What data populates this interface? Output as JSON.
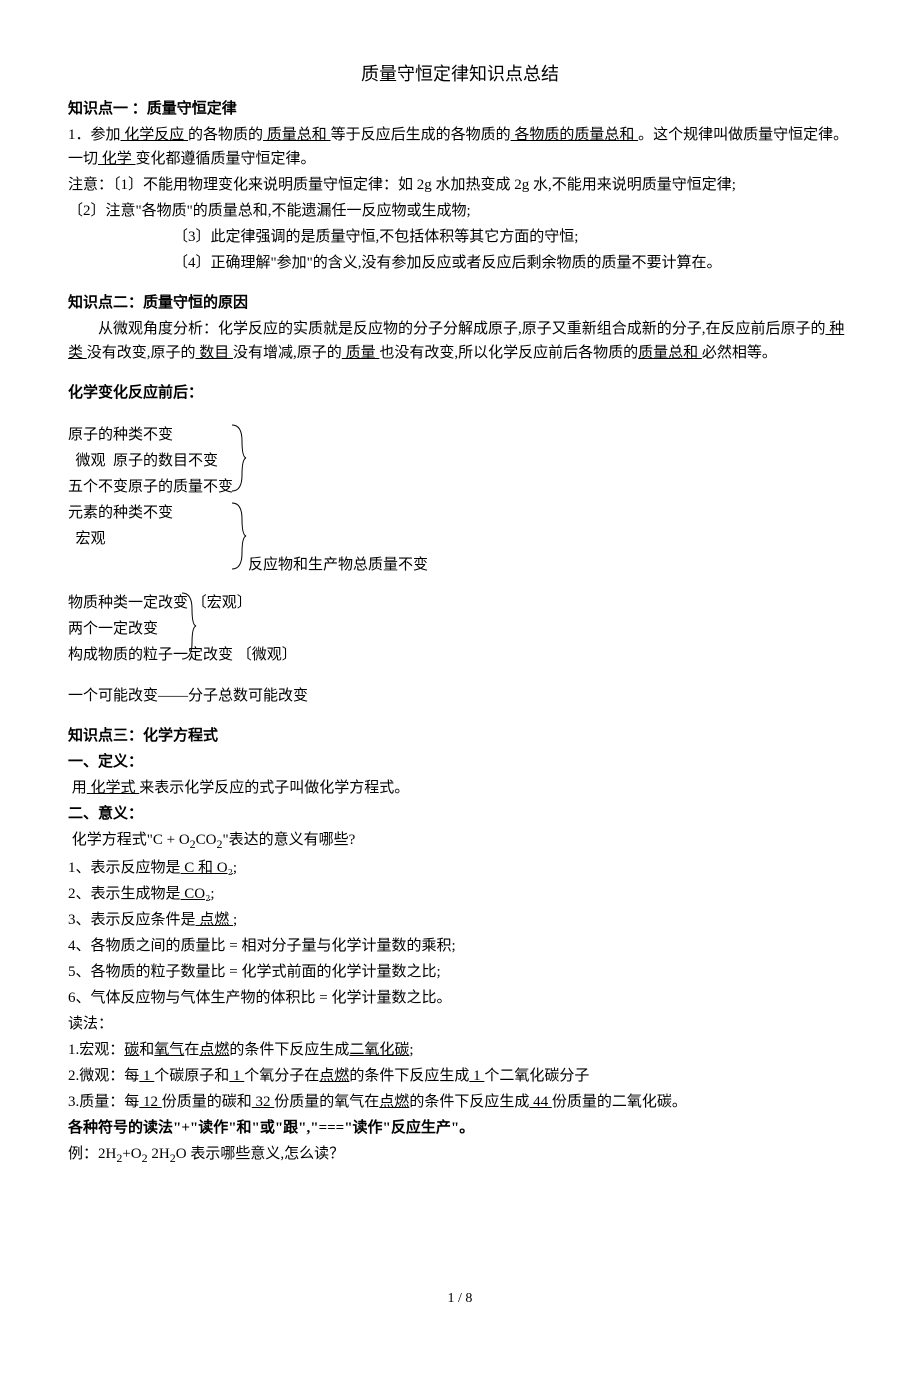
{
  "title": "质量守恒定律知识点总结",
  "kp1": {
    "heading": "知识点一 ：质量守恒定律",
    "p1_a": "1．参加",
    "p1_u1": " 化学反应 ",
    "p1_b": "的各物质的",
    "p1_u2": " 质量总和 ",
    "p1_c": "等于反应后生成的各物质的",
    "p1_u3": " 各物质的质量总和 ",
    "p1_d": "。这个规律叫做质量守恒定律。一切",
    "p1_u4": " 化学 ",
    "p1_e": "变化都遵循质量守恒定律。",
    "note1": "注意：〔1〕不能用物理变化来说明质量守恒定律：如 2g 水加热变成 2g 水,不能用来说明质量守恒定律;",
    "note2": "〔2〕注意\"各物质\"的质量总和,不能遗漏任一反应物或生成物;",
    "note3": "〔3〕此定律强调的是质量守恒,不包括体积等其它方面的守恒;",
    "note4": "〔4〕正确理解\"参加\"的含义,没有参加反应或者反应后剩余物质的质量不要计算在。"
  },
  "kp2": {
    "heading": "知识点二：质量守恒的原因",
    "p_a": "从微观角度分析：化学反应的实质就是反应物的分子分解成原子,原子又重新组合成新的分子,在反应前后原子的",
    "p_u1": " 种类   ",
    "p_b": "没有改变,原子的",
    "p_u2": " 数目 ",
    "p_c": "没有增减,原子的",
    "p_u3": " 质量  ",
    "p_d": "也没有改变,所以化学反应前后各物质的",
    "p_u4": "质量总和 ",
    "p_e": "必然相等。"
  },
  "change": {
    "heading": "化学变化反应前后：",
    "f1": "原子的种类不变",
    "f2_a": "微观",
    "f2_b": "原子的数目不变",
    "f3": "五个不变原子的质量不变",
    "f4": "元素的种类不变",
    "f5_a": "宏观",
    "f5_b": "反应物和生产物总质量不变",
    "g1": "物质种类一定改变  〔宏观〕",
    "g2": "两个一定改变",
    "g3": "构成物质的粒子一定改变 〔微观〕",
    "g4": "一个可能改变——分子总数可能改变"
  },
  "kp3": {
    "heading": "知识点三：化学方程式",
    "d1": "一、定义：",
    "d1_a": "用",
    "d1_u": " 化学式 ",
    "d1_b": "来表示化学反应的式子叫做化学方程式。",
    "d2": "二、意义：",
    "d2_a": "化学方程式\"C + O",
    "d2_b": "CO",
    "d2_c": "\"表达的意义有哪些?",
    "m1_a": "1、表示反应物是",
    "m1_u": " C 和 O₂",
    "m1_c": ";",
    "m2_a": "2、表示生成物是",
    "m2_u": " CO₂",
    "m2_c": ";",
    "m3_a": "3、表示反应条件是",
    "m3_u": " 点燃 ",
    "m3_c": ";",
    "m4": "4、各物质之间的质量比 = 相对分子量与化学计量数的乘积;",
    "m5": "5、各物质的粒子数量比 = 化学式前面的化学计量数之比;",
    "m6": "6、气体反应物与气体生产物的体积比 = 化学计量数之比。",
    "read": "读法：",
    "r1_a": "1.宏观：",
    "r1_u1": "碳",
    "r1_b": "和",
    "r1_u2": "氧气",
    "r1_c": "在",
    "r1_u3": "点燃",
    "r1_d": "的条件下反应生成",
    "r1_u4": "二氧化碳",
    "r1_e": ";",
    "r2_a": "2.微观：每",
    "r2_u1": " 1 ",
    "r2_b": "个碳原子和",
    "r2_u2": " 1 ",
    "r2_c": "个氧分子在",
    "r2_u3": "点燃",
    "r2_d": "的条件下反应生成",
    "r2_u4": " 1 ",
    "r2_e": "个二氧化碳分子",
    "r3_a": "3.质量：每",
    "r3_u1": " 12 ",
    "r3_b": "份质量的碳和",
    "r3_u2": " 32 ",
    "r3_c": "份质量的氧气在",
    "r3_u3": "点燃",
    "r3_d": "的条件下反应生成",
    "r3_u4": " 44 ",
    "r3_e": "份质量的二氧化碳。",
    "sym": "各种符号的读法\"+\"读作\"和\"或\"跟\",\"===\"读作\"反应生产\"。",
    "ex_a": "例：2H",
    "ex_b": "+O",
    "ex_c": "   2H",
    "ex_d": "O 表示哪些意义,怎么读？"
  },
  "footer": "1 / 8"
}
